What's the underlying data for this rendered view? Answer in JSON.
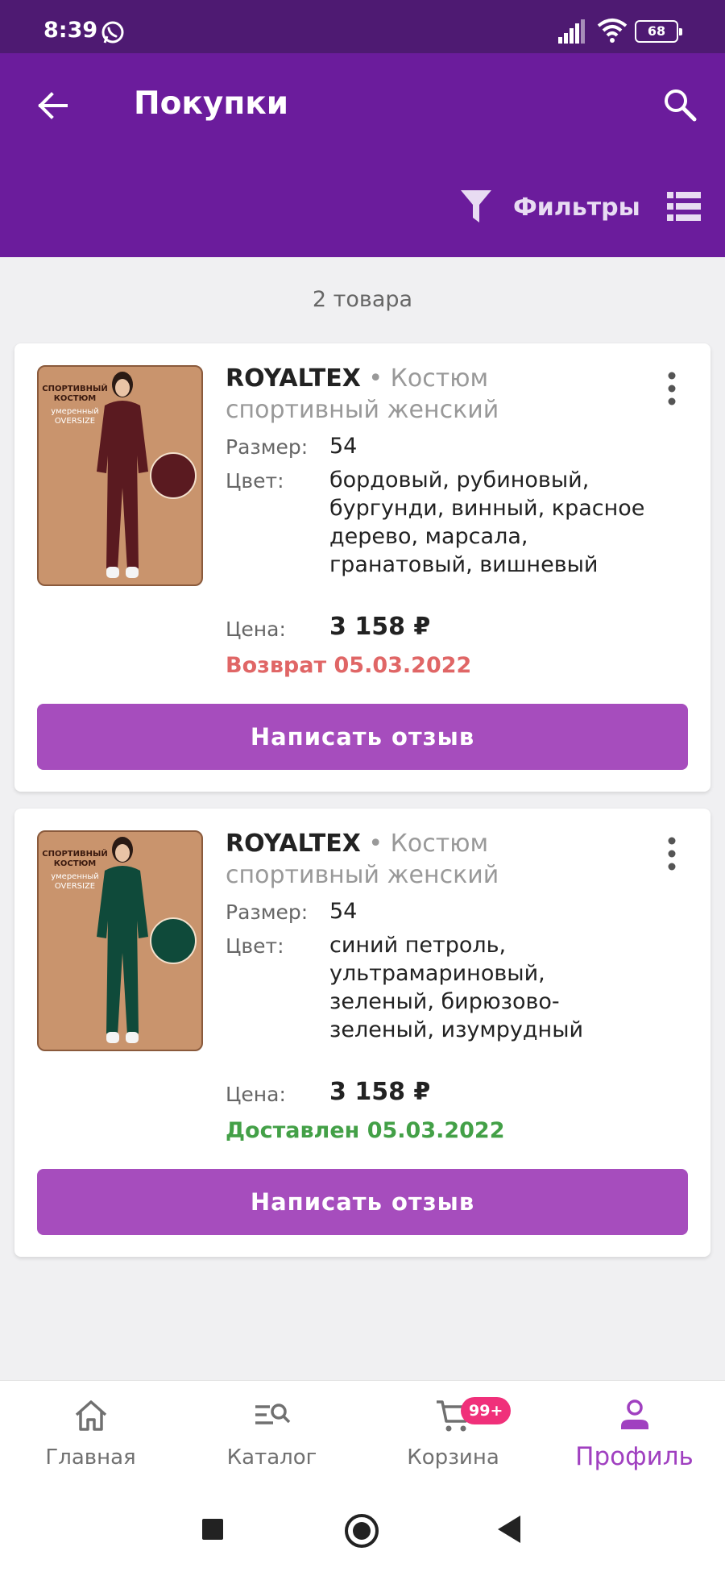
{
  "status_bar": {
    "time": "8:39",
    "battery": "68"
  },
  "app_bar": {
    "title": "Покупки",
    "filters_label": "Фильтры"
  },
  "count_label": "2 товара",
  "orders": [
    {
      "brand": "ROYALTEX",
      "separator": " • ",
      "name": "Костюм спортивный женский",
      "size_label": "Размер:",
      "size": "54",
      "color_label": "Цвет:",
      "color": "бордовый, рубиновый, бургунди, винный, красное дерево, марсала, гранатовый, вишневый",
      "price_label": "Цена:",
      "price": "3 158 ₽",
      "status": "Возврат 05.03.2022",
      "status_color": "#e06666",
      "button_label": "Написать отзыв",
      "thumb_title": "СПОРТИВНЫЙ КОСТЮМ",
      "thumb_subtitle": "умеренный OVERSIZE",
      "garment_color": "#5a1a20"
    },
    {
      "brand": "ROYALTEX",
      "separator": " • ",
      "name": "Костюм спортивный женский",
      "size_label": "Размер:",
      "size": "54",
      "color_label": "Цвет:",
      "color": "синий петроль, ультрамариновый, зеленый, бирюзово-зеленый, изумрудный",
      "price_label": "Цена:",
      "price": "3 158 ₽",
      "status": "Доставлен 05.03.2022",
      "status_color": "#43a047",
      "button_label": "Написать отзыв",
      "thumb_title": "СПОРТИВНЫЙ КОСТЮМ",
      "thumb_subtitle": "умеренный OVERSIZE",
      "garment_color": "#0f4a3a"
    }
  ],
  "bottom_nav": [
    {
      "label": "Главная",
      "icon": "home-icon",
      "active": false
    },
    {
      "label": "Каталог",
      "icon": "catalog-search-icon",
      "active": false
    },
    {
      "label": "Корзина",
      "icon": "cart-icon",
      "active": false,
      "badge": "99+"
    },
    {
      "label": "Профиль",
      "icon": "profile-icon",
      "active": true
    }
  ],
  "colors": {
    "status_bar": "#4e1a72",
    "app_bar": "#6b1c9c",
    "accent": "#a64dbd",
    "badge": "#f0307a"
  }
}
